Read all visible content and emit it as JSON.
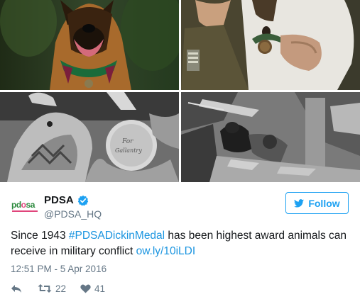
{
  "tweet": {
    "author": {
      "display_name": "PDSA",
      "handle": "@PDSA_HQ",
      "verified": true,
      "logo_text": "pd",
      "logo_dot": "o",
      "logo_tail": "sa"
    },
    "follow_label": "Follow",
    "text": {
      "prefix": "Since 1943 ",
      "hashtag": "#PDSADickinMedal",
      "middle": " has been highest award animals can receive in military conflict ",
      "link": "ow.ly/10iLDI"
    },
    "timestamp": "12:51 PM - 5 Apr 2016",
    "retweets": "22",
    "likes": "41",
    "icons": {
      "verified": "verified-check-icon",
      "follow": "twitter-bird-icon",
      "reply": "reply-arrow-icon",
      "retweet": "retweet-icon",
      "like": "heart-icon"
    }
  },
  "photos": [
    {
      "id": "dog-with-medal",
      "description_icon": "photo"
    },
    {
      "id": "soldier-with-dog",
      "description_icon": "photo"
    },
    {
      "id": "pigeon-with-medal",
      "description_icon": "photo"
    },
    {
      "id": "rescue-dog-rubble",
      "description_icon": "photo"
    }
  ],
  "colors": {
    "accent": "#1da1f2",
    "link": "#1b95e0",
    "muted": "#657786",
    "text": "#14171a",
    "logo_green": "#2d8a3e",
    "logo_pink": "#e0457b"
  }
}
